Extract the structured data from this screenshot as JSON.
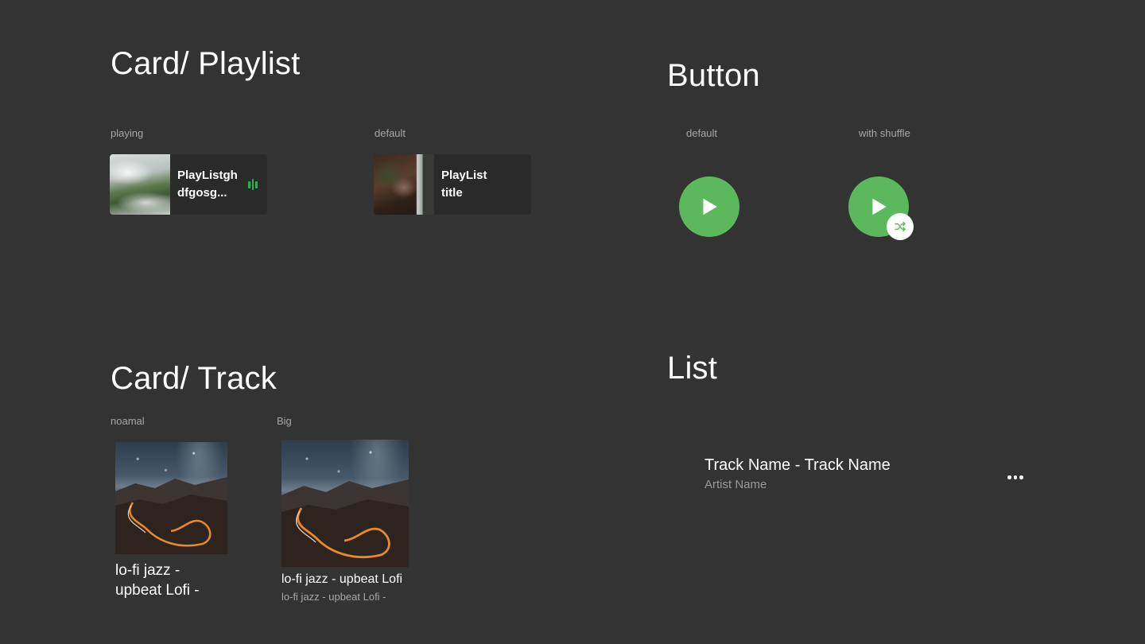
{
  "sections": {
    "playlist_title": "Card/ Playlist",
    "button_title": "Button",
    "track_title": "Card/ Track",
    "list_title": "List"
  },
  "playlist_cards": {
    "playing": {
      "variant_label": "playing",
      "line1": "PlayListgh",
      "line2": "dfgosg..."
    },
    "default": {
      "variant_label": "default",
      "line1": "PlayList",
      "line2": "title"
    }
  },
  "buttons": {
    "default_label": "default",
    "shuffle_label": "with shuffle"
  },
  "track_cards": {
    "normal": {
      "variant_label": "noamal",
      "line1": "lo-fi jazz -",
      "line2": "upbeat Lofi -"
    },
    "big": {
      "variant_label": "Big",
      "title": "lo-fi jazz - upbeat Lofi",
      "subtitle": "lo-fi jazz - upbeat Lofi -"
    }
  },
  "list_item": {
    "title": "Track Name - Track Name",
    "artist": "Artist Name"
  },
  "colors": {
    "background": "#333333",
    "card": "#2a2a2a",
    "accent_green": "#5cb85c",
    "eq_green": "#1db954",
    "muted_text": "#a7a7a7"
  },
  "icons": {
    "play": "play-icon",
    "shuffle": "shuffle-icon",
    "equalizer": "equalizer-icon",
    "more": "more-horizontal-icon"
  }
}
